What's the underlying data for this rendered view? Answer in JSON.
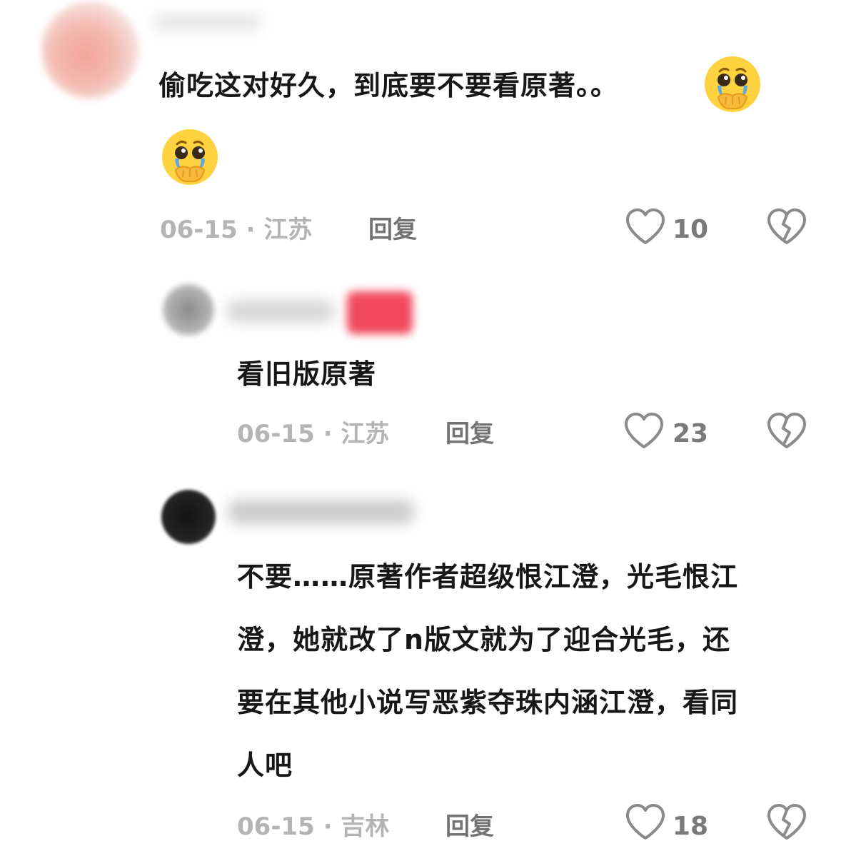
{
  "comments": [
    {
      "text_line1": "偷吃这对好久，到底要不要看原著。。",
      "meta": "06-15 · 江苏",
      "reply": "回复",
      "likes": "10",
      "emoji": "crying-hands-face-emoji"
    },
    {
      "text_line1": "看旧版原著",
      "meta": "06-15 · 江苏",
      "reply": "回复",
      "likes": "23"
    },
    {
      "text_line1": "不要……原著作者超级恨江澄，光毛恨江",
      "text_line2": "澄，她就改了n版文就为了迎合光毛，还",
      "text_line3": "要在其他小说写恶紫夺珠内涵江澄，看同",
      "text_line4": "人吧",
      "meta": "06-15 · 吉林",
      "reply": "回复",
      "likes": "18"
    }
  ],
  "icons": {
    "like": "heart-outline-icon",
    "dislike": "broken-heart-icon"
  },
  "colors": {
    "text": "#171717",
    "meta": "#b4b4b4",
    "reply": "#737373",
    "icon": "#8a8a8a"
  }
}
